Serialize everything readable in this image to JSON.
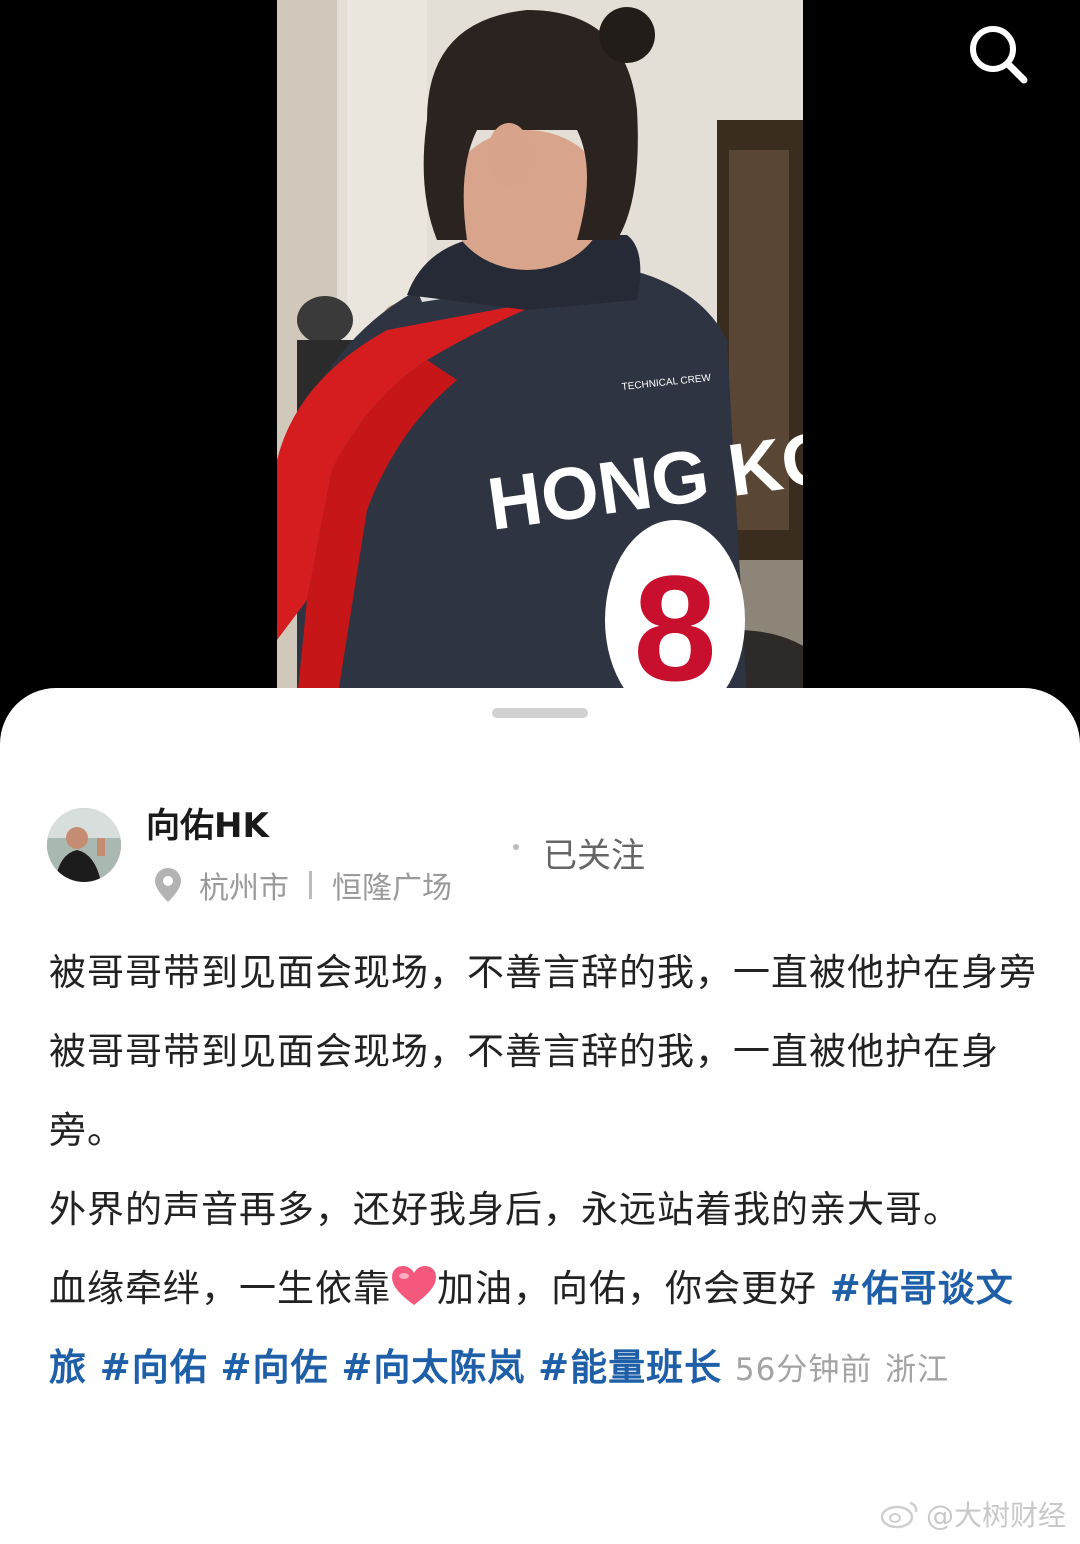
{
  "video": {
    "jersey_text": "HONG KON",
    "jersey_number": "8",
    "search_icon": "search-icon"
  },
  "post": {
    "author": "向佑HK",
    "follow_status": "已关注",
    "location_city": "杭州市",
    "location_place": "恒隆广场",
    "line1": "被哥哥带到见面会现场，不善言辞的我，一直被他护在身旁 被哥哥带到见面会现场，不善言辞的我，一直被他护在身旁。",
    "line2": "外界的声音再多，还好我身后，永远站着我的亲大哥。",
    "line3_before_emoji": "血缘牵绊，一生依靠",
    "line3_after_emoji": "加油，向佑，你会更好 ",
    "hashtags": [
      "#佑哥谈文旅",
      "#向佑",
      "#向佐",
      "#向太陈岚",
      "#能量班长"
    ],
    "time_ago": "56分钟前",
    "region": "浙江",
    "emoji": "heart-emoji"
  },
  "watermark": "@大树财经",
  "colors": {
    "hashtag": "#1e5fa8",
    "sheet_bg": "#ffffff",
    "page_bg": "#000000"
  }
}
